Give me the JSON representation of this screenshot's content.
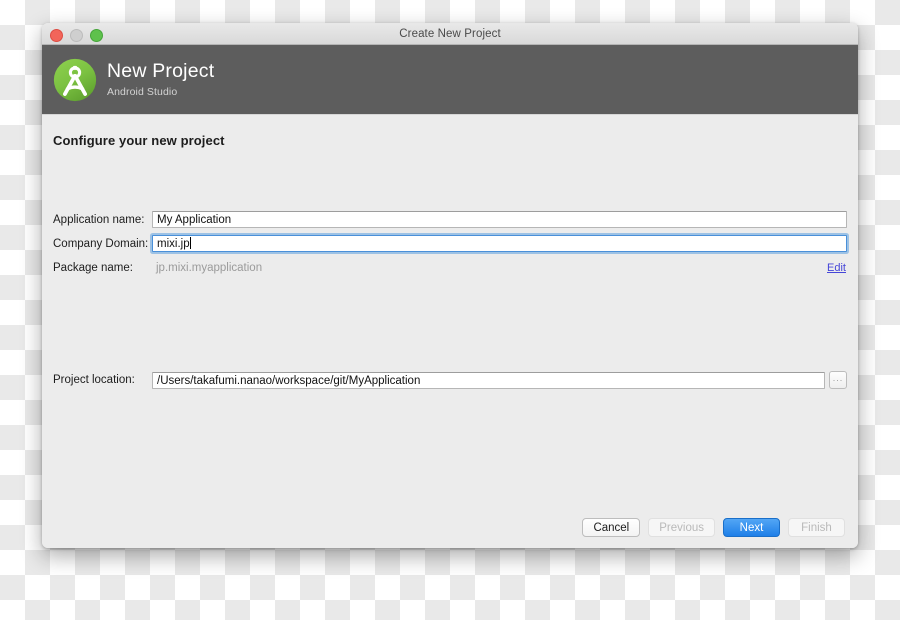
{
  "window": {
    "title": "Create New Project",
    "controls": [
      {
        "name": "close",
        "color": "#f2655a"
      },
      {
        "name": "minimize",
        "color": "#cfcfcf"
      },
      {
        "name": "maximize",
        "color": "#5ec14c"
      }
    ]
  },
  "banner": {
    "title": "New Project",
    "subtitle": "Android Studio",
    "logo_icon": "android-studio-logo-icon",
    "bg_color": "#5d5d5d",
    "logo_color": "#7cc242"
  },
  "page": {
    "heading": "Configure your new project"
  },
  "fields": {
    "application_name": {
      "label": "Application name:",
      "value": "My Application",
      "focused": false
    },
    "company_domain": {
      "label": "Company Domain:",
      "value": "mixi.jp",
      "focused": true
    },
    "package_name": {
      "label": "Package name:",
      "value": "jp.mixi.myapplication",
      "edit_label": "Edit",
      "edit_color": "#4646d8"
    },
    "project_location": {
      "label": "Project location:",
      "value": "/Users/takafumi.nanao/workspace/git/MyApplication",
      "browse_label": "..."
    }
  },
  "footer": {
    "cancel": {
      "label": "Cancel",
      "state": "normal"
    },
    "previous": {
      "label": "Previous",
      "state": "disabled"
    },
    "next": {
      "label": "Next",
      "state": "primary",
      "color": "#2a87ea"
    },
    "finish": {
      "label": "Finish",
      "state": "disabled"
    }
  }
}
